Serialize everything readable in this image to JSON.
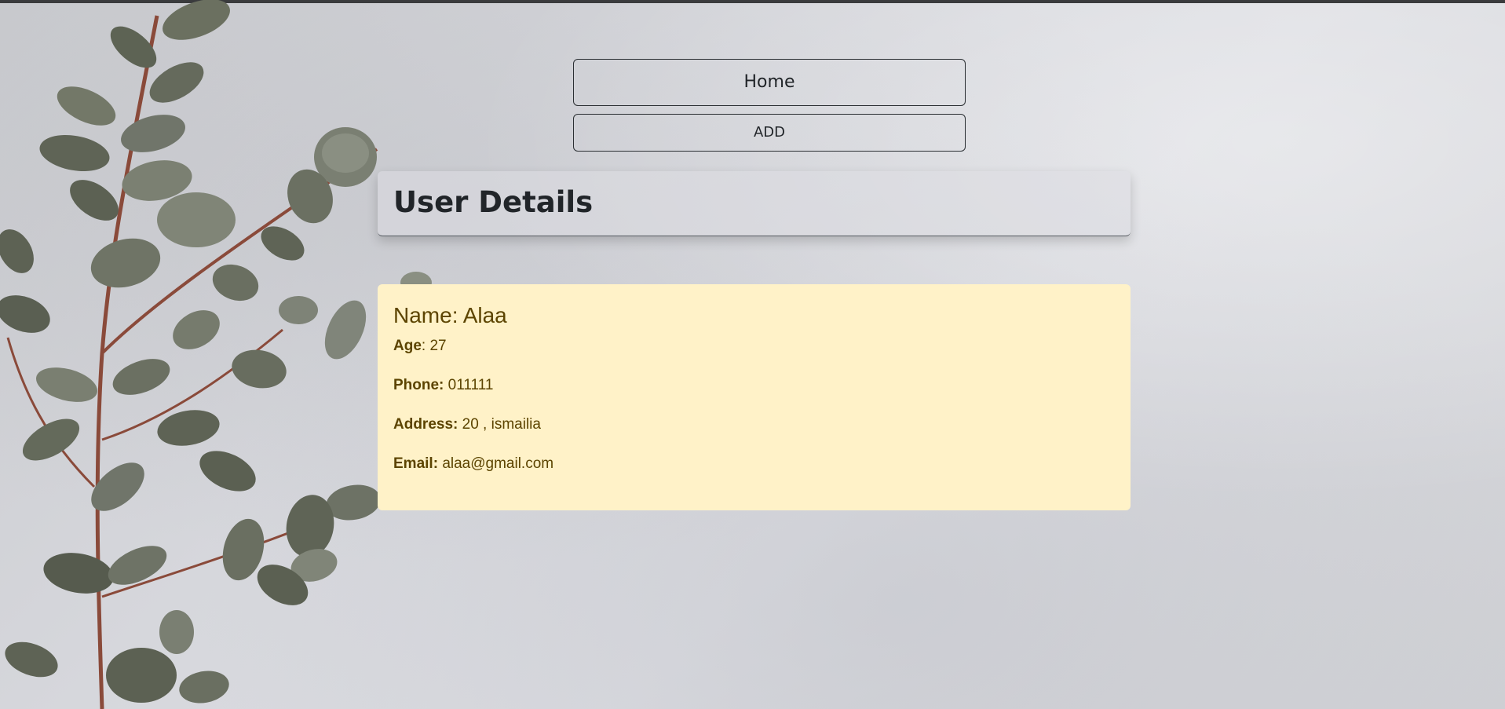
{
  "nav": {
    "home_label": "Home",
    "add_label": "ADD"
  },
  "header": {
    "title": "User Details"
  },
  "user": {
    "name_label": "Name:",
    "name_value": "Alaa",
    "age_label": "Age",
    "age_value": ": 27",
    "phone_label": "Phone:",
    "phone_value": "011111",
    "address_label": "Address:",
    "address_value": "20 , ismailia",
    "email_label": "Email:",
    "email_value": "alaa@gmail.com"
  },
  "colors": {
    "card_background": "#fff2c8",
    "card_text": "#5c4400",
    "page_background": "#d6d7dc",
    "leaf_green": "#6b7060",
    "stem_red": "#8a4a3a"
  },
  "icons": {
    "background_decoration": "eucalyptus-plant"
  }
}
